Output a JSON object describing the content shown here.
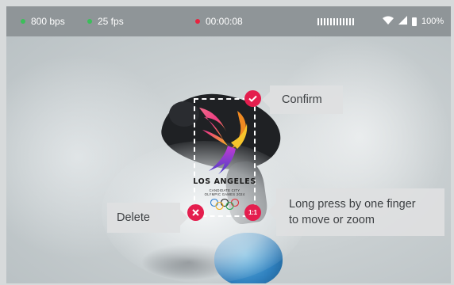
{
  "status_bar": {
    "bitrate": "800 bps",
    "framerate": "25 fps",
    "timer": "00:00:08",
    "battery": "100%",
    "indicator_color_good": "#3bbf5a",
    "indicator_color_record": "#e8233f",
    "icons": [
      "wifi-icon",
      "cell-signal-icon",
      "battery-icon"
    ]
  },
  "sticker": {
    "title": "LOS ANGELES",
    "subtitle_line1": "CANDIDATE CITY",
    "subtitle_line2": "OLYMPIC GAMES 2024"
  },
  "handles": {
    "confirm_icon": "check-icon",
    "delete_icon": "close-icon",
    "zoom_label": "1:1"
  },
  "tooltips": {
    "confirm": "Confirm",
    "delete": "Delete",
    "press_line1": "Long press by one finger",
    "press_line2": "to move or zoom"
  },
  "colors": {
    "accent": "#e41e4e",
    "tooltip_bg": "#dedfe0",
    "status_bar_bg": "#8f9598"
  }
}
